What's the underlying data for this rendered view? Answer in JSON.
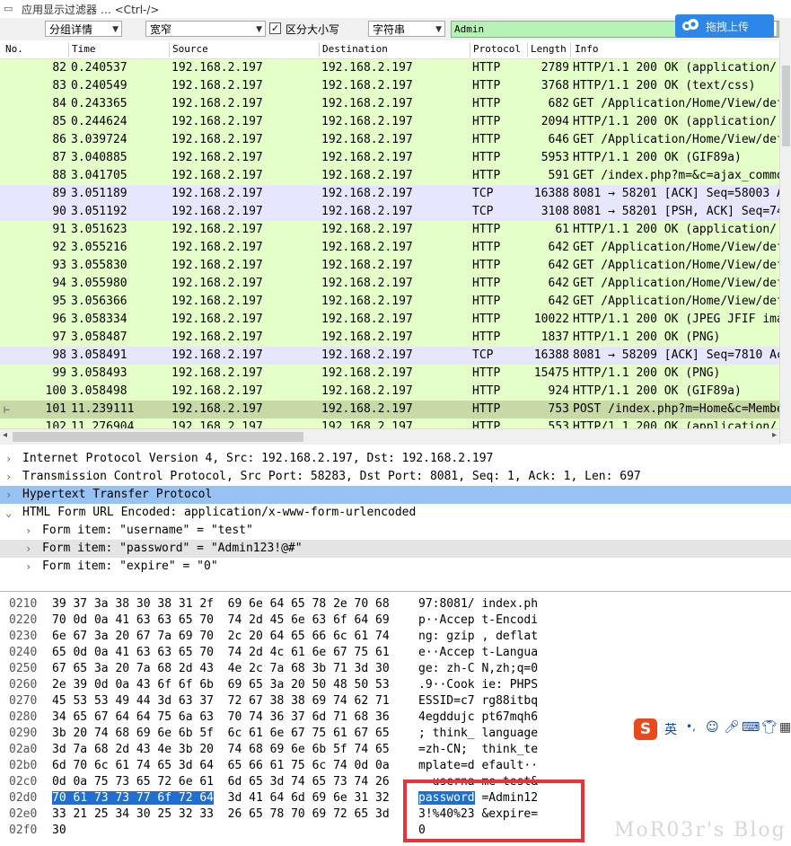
{
  "filter_bar": {
    "placeholder": "应用显示过滤器 … <Ctrl-/>"
  },
  "toolbar": {
    "search_in": "分组详情",
    "char_width": "宽窄",
    "case_label": "区分大小写",
    "case_checked": true,
    "search_type": "字符串",
    "search_value": "Admin",
    "upload_label": "拖拽上传"
  },
  "packet_list": {
    "columns": [
      "No.",
      "Time",
      "Source",
      "Destination",
      "Protocol",
      "Length",
      "Info"
    ],
    "rows": [
      {
        "no": "82",
        "time": "0.240537",
        "src": "192.168.2.197",
        "dst": "192.168.2.197",
        "proto": "HTTP",
        "len": "2789",
        "info": "HTTP/1.1 200 OK  (application/",
        "kind": "http"
      },
      {
        "no": "83",
        "time": "0.240549",
        "src": "192.168.2.197",
        "dst": "192.168.2.197",
        "proto": "HTTP",
        "len": "3768",
        "info": "HTTP/1.1 200 OK  (text/css)",
        "kind": "http"
      },
      {
        "no": "84",
        "time": "0.243365",
        "src": "192.168.2.197",
        "dst": "192.168.2.197",
        "proto": "HTTP",
        "len": "682",
        "info": "GET /Application/Home/View/def",
        "kind": "http"
      },
      {
        "no": "85",
        "time": "0.244624",
        "src": "192.168.2.197",
        "dst": "192.168.2.197",
        "proto": "HTTP",
        "len": "2094",
        "info": "HTTP/1.1 200 OK  (application/",
        "kind": "http"
      },
      {
        "no": "86",
        "time": "3.039724",
        "src": "192.168.2.197",
        "dst": "192.168.2.197",
        "proto": "HTTP",
        "len": "646",
        "info": "GET /Application/Home/View/def",
        "kind": "http"
      },
      {
        "no": "87",
        "time": "3.040885",
        "src": "192.168.2.197",
        "dst": "192.168.2.197",
        "proto": "HTTP",
        "len": "5953",
        "info": "HTTP/1.1 200 OK  (GIF89a)",
        "kind": "http"
      },
      {
        "no": "88",
        "time": "3.041705",
        "src": "192.168.2.197",
        "dst": "192.168.2.197",
        "proto": "HTTP",
        "len": "591",
        "info": "GET /index.php?m=&c=ajax_commo",
        "kind": "http"
      },
      {
        "no": "89",
        "time": "3.051189",
        "src": "192.168.2.197",
        "dst": "192.168.2.197",
        "proto": "TCP",
        "len": "16388",
        "info": "8081 → 58201 [ACK] Seq=58003 A",
        "kind": "tcp"
      },
      {
        "no": "90",
        "time": "3.051192",
        "src": "192.168.2.197",
        "dst": "192.168.2.197",
        "proto": "TCP",
        "len": "3108",
        "info": "8081 → 58201 [PSH, ACK] Seq=74",
        "kind": "tcp"
      },
      {
        "no": "91",
        "time": "3.051623",
        "src": "192.168.2.197",
        "dst": "192.168.2.197",
        "proto": "HTTP",
        "len": "61",
        "info": "HTTP/1.1 200 OK  (application/",
        "kind": "http"
      },
      {
        "no": "92",
        "time": "3.055216",
        "src": "192.168.2.197",
        "dst": "192.168.2.197",
        "proto": "HTTP",
        "len": "642",
        "info": "GET /Application/Home/View/def",
        "kind": "http"
      },
      {
        "no": "93",
        "time": "3.055830",
        "src": "192.168.2.197",
        "dst": "192.168.2.197",
        "proto": "HTTP",
        "len": "642",
        "info": "GET /Application/Home/View/def",
        "kind": "http"
      },
      {
        "no": "94",
        "time": "3.055980",
        "src": "192.168.2.197",
        "dst": "192.168.2.197",
        "proto": "HTTP",
        "len": "642",
        "info": "GET /Application/Home/View/def",
        "kind": "http"
      },
      {
        "no": "95",
        "time": "3.056366",
        "src": "192.168.2.197",
        "dst": "192.168.2.197",
        "proto": "HTTP",
        "len": "642",
        "info": "GET /Application/Home/View/def",
        "kind": "http"
      },
      {
        "no": "96",
        "time": "3.058334",
        "src": "192.168.2.197",
        "dst": "192.168.2.197",
        "proto": "HTTP",
        "len": "10022",
        "info": "HTTP/1.1 200 OK  (JPEG JFIF ima",
        "kind": "http"
      },
      {
        "no": "97",
        "time": "3.058487",
        "src": "192.168.2.197",
        "dst": "192.168.2.197",
        "proto": "HTTP",
        "len": "1837",
        "info": "HTTP/1.1 200 OK  (PNG)",
        "kind": "http"
      },
      {
        "no": "98",
        "time": "3.058491",
        "src": "192.168.2.197",
        "dst": "192.168.2.197",
        "proto": "TCP",
        "len": "16388",
        "info": "8081 → 58209 [ACK] Seq=7810 Ac",
        "kind": "tcp"
      },
      {
        "no": "99",
        "time": "3.058493",
        "src": "192.168.2.197",
        "dst": "192.168.2.197",
        "proto": "HTTP",
        "len": "15475",
        "info": "HTTP/1.1 200 OK  (PNG)",
        "kind": "http"
      },
      {
        "no": "100",
        "time": "3.058498",
        "src": "192.168.2.197",
        "dst": "192.168.2.197",
        "proto": "HTTP",
        "len": "924",
        "info": "HTTP/1.1 200 OK  (GIF89a)",
        "kind": "http"
      },
      {
        "no": "101",
        "time": "11.239111",
        "src": "192.168.2.197",
        "dst": "192.168.2.197",
        "proto": "HTTP",
        "len": "753",
        "info": "POST /index.php?m=Home&c=Member",
        "kind": "selected"
      },
      {
        "no": "102",
        "time": "11.276904",
        "src": "192.168.2.197",
        "dst": "192.168.2.197",
        "proto": "HTTP",
        "len": "553",
        "info": "HTTP/1.1 200 OK  (application/",
        "kind": "http"
      }
    ]
  },
  "details": [
    {
      "text": "Internet Protocol Version 4, Src: 192.168.2.197, Dst: 192.168.2.197",
      "twisty": "›",
      "indent": 0,
      "state": "normal"
    },
    {
      "text": "Transmission Control Protocol, Src Port: 58283, Dst Port: 8081, Seq: 1, Ack: 1, Len: 697",
      "twisty": "›",
      "indent": 0,
      "state": "normal"
    },
    {
      "text": "Hypertext Transfer Protocol",
      "twisty": "›",
      "indent": 0,
      "state": "selected"
    },
    {
      "text": "HTML Form URL Encoded: application/x-www-form-urlencoded",
      "twisty": "⌄",
      "indent": 0,
      "state": "normal"
    },
    {
      "text": "Form item: \"username\" = \"test\"",
      "twisty": "›",
      "indent": 1,
      "state": "normal"
    },
    {
      "text": "Form item: \"password\" = \"Admin123!@#\"",
      "twisty": "›",
      "indent": 1,
      "state": "hover"
    },
    {
      "text": "Form item: \"expire\" = \"0\"",
      "twisty": "›",
      "indent": 1,
      "state": "normal"
    }
  ],
  "bytes": [
    {
      "off": "0210",
      "hex": "39 37 3a 38 30 38 31 2f  69 6e 64 65 78 2e 70 68",
      "ascii": "97:8081/ index.ph"
    },
    {
      "off": "0220",
      "hex": "70 0d 0a 41 63 63 65 70  74 2d 45 6e 63 6f 64 69",
      "ascii": "p··Accep t-Encodi"
    },
    {
      "off": "0230",
      "hex": "6e 67 3a 20 67 7a 69 70  2c 20 64 65 66 6c 61 74",
      "ascii": "ng: gzip , deflat"
    },
    {
      "off": "0240",
      "hex": "65 0d 0a 41 63 63 65 70  74 2d 4c 61 6e 67 75 61",
      "ascii": "e··Accep t-Langua"
    },
    {
      "off": "0250",
      "hex": "67 65 3a 20 7a 68 2d 43  4e 2c 7a 68 3b 71 3d 30",
      "ascii": "ge: zh-C N,zh;q=0"
    },
    {
      "off": "0260",
      "hex": "2e 39 0d 0a 43 6f 6f 6b  69 65 3a 20 50 48 50 53",
      "ascii": ".9··Cook ie: PHPS"
    },
    {
      "off": "0270",
      "hex": "45 53 53 49 44 3d 63 37  72 67 38 38 69 74 62 71",
      "ascii": "ESSID=c7 rg88itbq"
    },
    {
      "off": "0280",
      "hex": "34 65 67 64 64 75 6a 63  70 74 36 37 6d 71 68 36",
      "ascii": "4egddujc pt67mqh6"
    },
    {
      "off": "0290",
      "hex": "3b 20 74 68 69 6e 6b 5f  6c 61 6e 67 75 61 67 65",
      "ascii": "; think_ language"
    },
    {
      "off": "02a0",
      "hex": "3d 7a 68 2d 43 4e 3b 20  74 68 69 6e 6b 5f 74 65",
      "ascii": "=zh-CN;  think_te"
    },
    {
      "off": "02b0",
      "hex": "6d 70 6c 61 74 65 3d 64  65 66 61 75 6c 74 0d 0a",
      "ascii": "mplate=d efault··"
    },
    {
      "off": "02c0",
      "hex": "0d 0a 75 73 65 72 6e 61  6d 65 3d 74 65 73 74 26",
      "ascii": "··userna me=test&"
    },
    {
      "off": "02d0",
      "hex_hl": "70 61 73 73 77 6f 72 64",
      "hex_rest": "  3d 41 64 6d 69 6e 31 32",
      "ascii_hl": "password",
      "ascii_rest": " =Admin12"
    },
    {
      "off": "02e0",
      "hex": "33 21 25 34 30 25 32 33  26 65 78 70 69 72 65 3d",
      "ascii": "3!%40%23 &expire="
    },
    {
      "off": "02f0",
      "hex": "30",
      "ascii": "0"
    }
  ],
  "ime": {
    "lang": "英",
    "logo": "S"
  },
  "watermark": "MoR03r's Blog",
  "colors": {
    "http": "#e4ffc7",
    "tcp": "#e7e6ff",
    "selected": "#c9d9a5",
    "detail_selected": "#97c2f4",
    "detail_hover": "#e4e4e4",
    "hex_highlight": "#1f6fd0",
    "annotation": "#e8333a"
  }
}
